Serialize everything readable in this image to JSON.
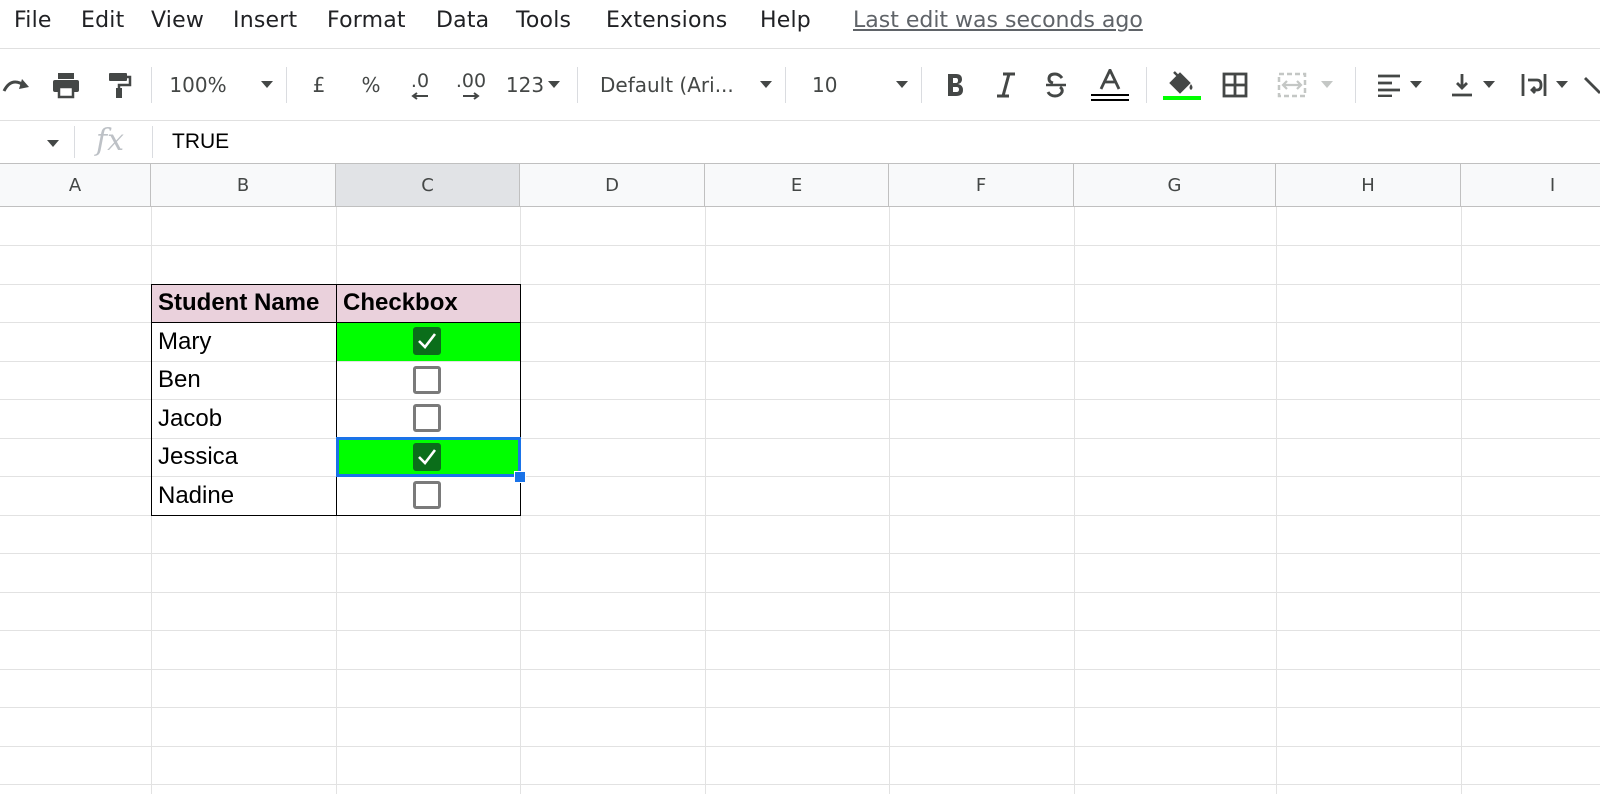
{
  "menu": {
    "items": [
      "File",
      "Edit",
      "View",
      "Insert",
      "Format",
      "Data",
      "Tools",
      "Extensions",
      "Help"
    ],
    "last_edit": "Last edit was seconds ago"
  },
  "toolbar": {
    "zoom": "100%",
    "currency": "£",
    "percent": "%",
    "decrease_decimal": ".0",
    "increase_decimal": ".00",
    "more_formats": "123",
    "font": "Default (Ari...",
    "font_size": "10",
    "colors": {
      "fill_underline": "#00ff00",
      "text_underline": "#000000"
    }
  },
  "formula_bar": {
    "fx": "fx",
    "value": "TRUE"
  },
  "columns": [
    "A",
    "B",
    "C",
    "D",
    "E",
    "F",
    "G",
    "H",
    "I"
  ],
  "selected_column": "C",
  "table": {
    "headers": [
      "Student Name",
      "Checkbox"
    ],
    "rows": [
      {
        "name": "Mary",
        "checked": true
      },
      {
        "name": "Ben",
        "checked": false
      },
      {
        "name": "Jacob",
        "checked": false
      },
      {
        "name": "Jessica",
        "checked": true
      },
      {
        "name": "Nadine",
        "checked": false
      }
    ],
    "colors": {
      "header_bg": "#ead1dc",
      "checked_bg": "#00ff00",
      "checkbox_checked": "#0b6e1a"
    }
  }
}
